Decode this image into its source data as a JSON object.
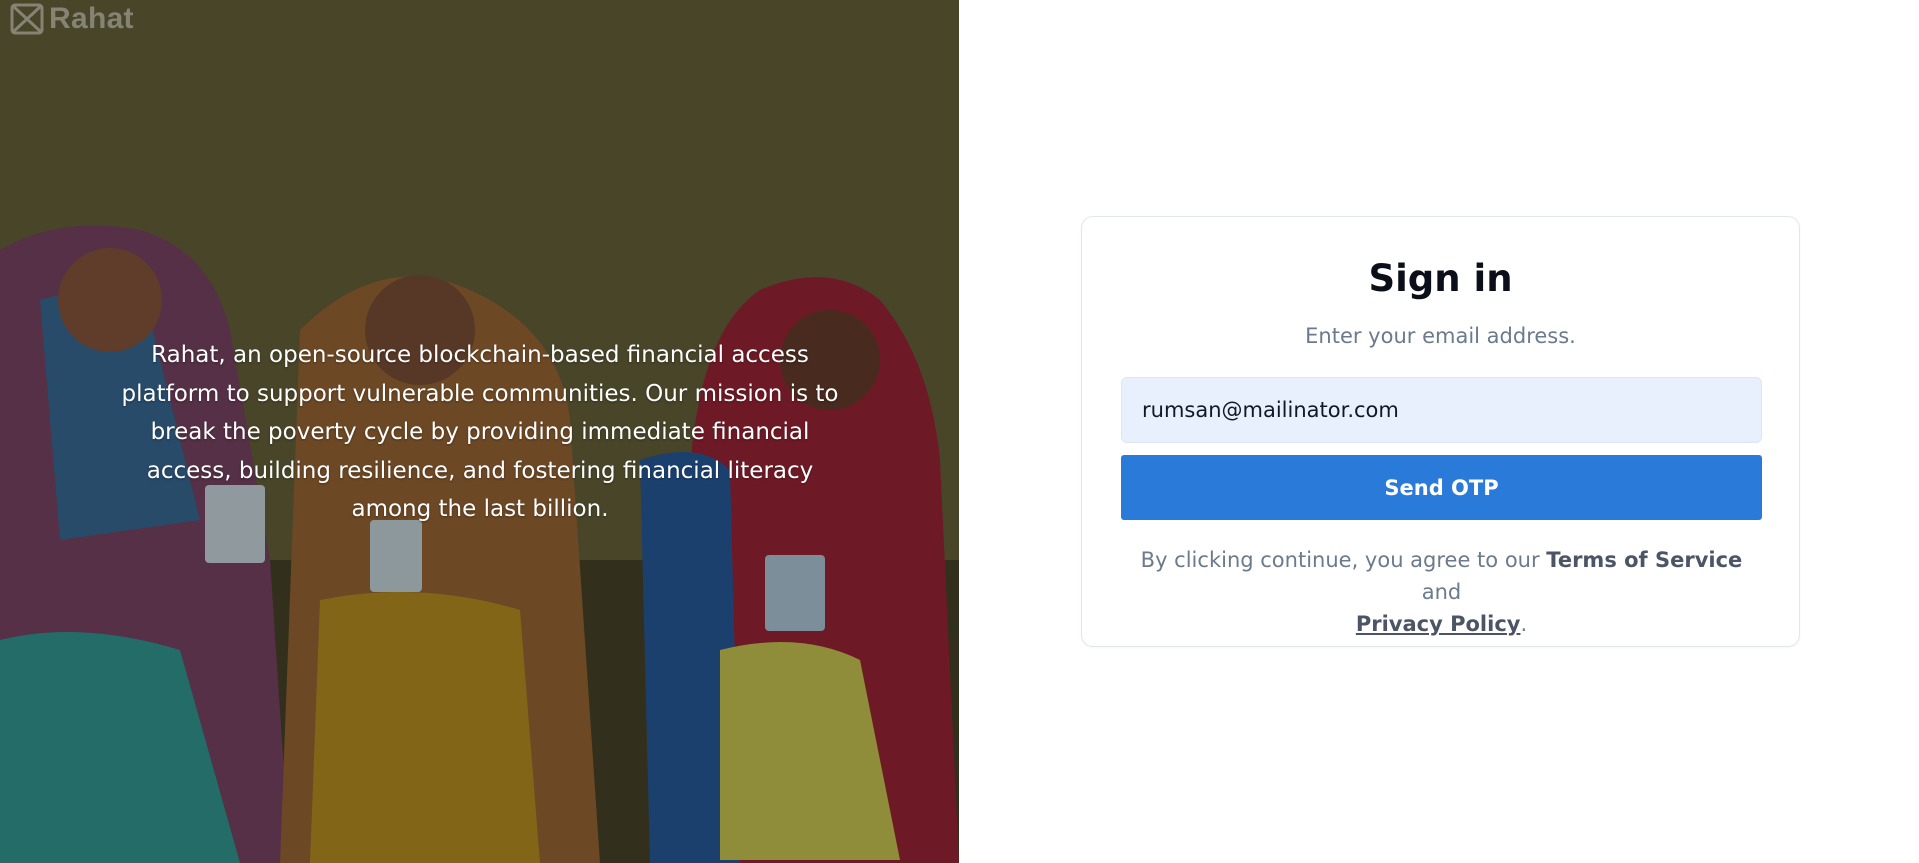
{
  "brand": {
    "name": "Rahat",
    "icon": "rahat-logo-icon"
  },
  "hero": {
    "description": "Rahat, an open-source blockchain-based financial access platform to support vulnerable communities. Our mission is to break the poverty cycle by providing immediate financial access, building resilience, and fostering financial literacy among the last billion."
  },
  "signin": {
    "title": "Sign in",
    "subtitle": "Enter your email address.",
    "email_value": "rumsan@mailinator.com",
    "submit_label": "Send OTP",
    "legal_prefix": "By clicking continue, you agree to our ",
    "terms_label": "Terms of Service",
    "legal_and": " and",
    "privacy_label": "Privacy Policy",
    "legal_suffix": "."
  },
  "colors": {
    "primary": "#2a7ad9",
    "input_bg": "#e8f0fe",
    "muted_text": "#6b7a8c",
    "heading": "#0b0f19"
  }
}
